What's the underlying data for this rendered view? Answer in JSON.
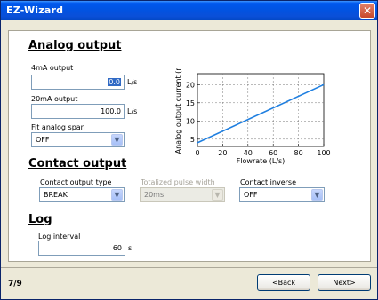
{
  "window": {
    "title": "EZ-Wizard",
    "close_glyph": "✕"
  },
  "analog": {
    "heading": "Analog output",
    "ma4": {
      "label": "4mA output",
      "value": "0.0",
      "unit": "L/s"
    },
    "ma20": {
      "label": "20mA output",
      "value": "100.0",
      "unit": "L/s"
    },
    "fit": {
      "label": "Fit analog span",
      "value": "OFF"
    }
  },
  "chart_data": {
    "type": "line",
    "xlabel": "Flowrate (L/s)",
    "ylabel": "Analog output current (n",
    "xlim": [
      0,
      100
    ],
    "ylim": [
      3,
      23
    ],
    "x_ticks": [
      "0",
      "20",
      "40",
      "60",
      "80",
      "100"
    ],
    "y_ticks": [
      "5",
      "10",
      "15",
      "20"
    ],
    "grid": true,
    "series": [
      {
        "x": [
          0,
          100
        ],
        "y": [
          4,
          20
        ],
        "color": "#1f7fe0"
      }
    ]
  },
  "contact": {
    "heading": "Contact output",
    "type": {
      "label": "Contact output type",
      "value": "BREAK"
    },
    "pulse": {
      "label": "Totalized pulse width",
      "value": "20ms"
    },
    "inverse": {
      "label": "Contact inverse",
      "value": "OFF"
    }
  },
  "log": {
    "heading": "Log",
    "interval": {
      "label": "Log interval",
      "value": "60",
      "unit": "s"
    }
  },
  "footer": {
    "page": "7/9",
    "back_label": "<Back",
    "next_label": "Next>"
  },
  "icons": {
    "dropdown": "chevron-down-icon",
    "close": "close-icon"
  },
  "colors": {
    "titlebar": "#0054e3",
    "series": "#1f7fe0",
    "face": "#ece9d8"
  }
}
